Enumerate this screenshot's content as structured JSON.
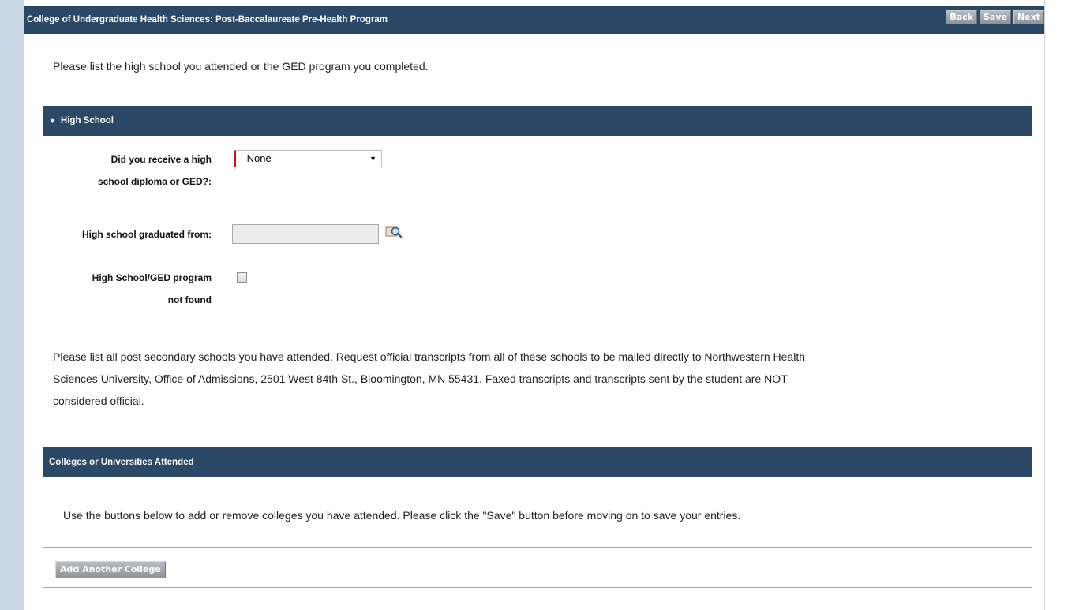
{
  "header": {
    "title": "College of Undergraduate Health Sciences: Post-Baccalaureate Pre-Health Program",
    "buttons": {
      "back": "Back",
      "save": "Save",
      "next": "Next"
    }
  },
  "intro_text": "Please list the high school you attended or the GED program you completed.",
  "high_school_section": {
    "title": "High School",
    "diploma_question_line1": "Did you receive a high",
    "diploma_question_line2": "school diploma or GED?:",
    "diploma_select_value": "--None--",
    "graduated_from_label": "High school graduated from:",
    "graduated_from_value": "",
    "not_found_label_line1": "High School/GED program",
    "not_found_label_line2": "not found",
    "not_found_checked": false
  },
  "post_secondary_text": {
    "line1": "Please list all post secondary schools you have attended. Request official transcripts from all of these schools to be mailed directly to Northwestern Health",
    "line2": "Sciences University, Office of Admissions, 2501 West 84th St., Bloomington, MN 55431. Faxed transcripts and transcripts sent by the student are NOT",
    "line3": "considered official."
  },
  "colleges_section": {
    "title": "Colleges or Universities Attended",
    "instructions": "Use the buttons below to add or remove colleges you have attended. Please click the \"Save\" button before moving on to save your entries.",
    "add_button": "Add Another College"
  },
  "colors": {
    "header_bg": "#2b4866",
    "required_marker": "#cc1111",
    "left_rail": "#c9d7e4"
  }
}
